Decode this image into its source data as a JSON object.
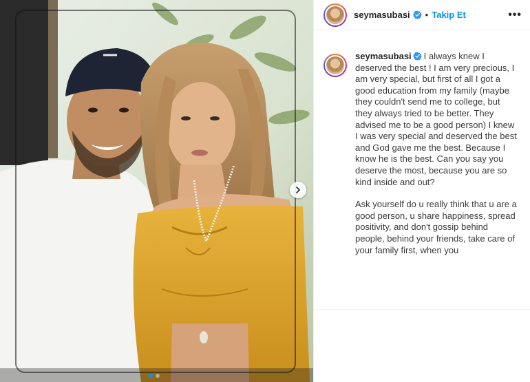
{
  "post": {
    "username": "seymasubasi",
    "follow_label": "Takip Et",
    "bullet": "•",
    "more_label": "•••",
    "verified_icon": "verified-badge-icon",
    "accent_color": "#0095f6"
  },
  "caption": {
    "username": "seymasubasi",
    "paragraph1": "I always knew I deserved the best ! I am very precious, I am very special, but first of all I got a good education from my family (maybe they couldn't send me to college, but they always tried to be better. They advised me to be a good person) I knew I was very special and deserved the best and God gave me the best. Because I know he is the best. Can you say you deserve the most, because you are so kind inside and out?",
    "paragraph2": "Ask yourself do u really think that u are a good person, u share happiness, spread positivity, and don't gossip behind people, behind your friends, take care of your family first, when you"
  },
  "carousel": {
    "total_slides": 2,
    "active_slide": 1
  }
}
